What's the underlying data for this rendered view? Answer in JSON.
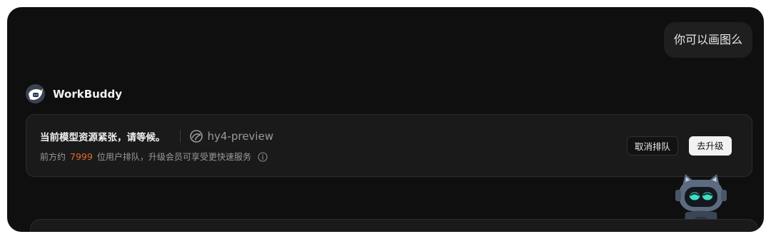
{
  "user_message": {
    "text": "你可以画图么"
  },
  "bot": {
    "name": "WorkBuddy",
    "avatar_icon": "workbuddy-avatar-icon"
  },
  "queue_notice": {
    "title": "当前模型资源紧张，请等候。",
    "model_icon": "hunyuan-logo-icon",
    "model_name": "hy4-preview",
    "subtitle_before": "前方约",
    "queue_count": "7999",
    "subtitle_after": "位用户排队，升级会员可享受更快速服务",
    "info_icon": "info-circle-icon",
    "count_color": "#e06a2c"
  },
  "actions": {
    "cancel_label": "取消排队",
    "upgrade_label": "去升级"
  },
  "mascot": {
    "icon": "robot-cat-mascot-icon"
  }
}
